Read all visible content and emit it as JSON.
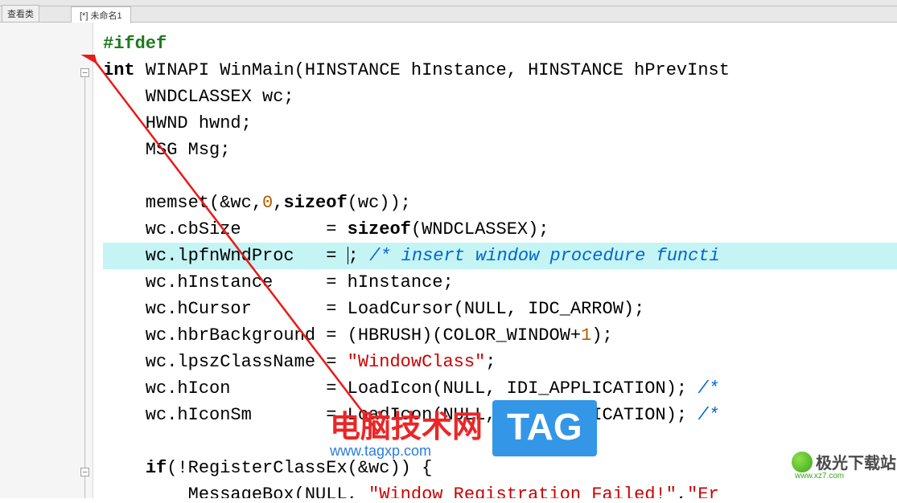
{
  "tabs": {
    "mini_label": "查看类",
    "doc_label": "[*] 未命名1"
  },
  "code": {
    "l1_a": "#ifdef",
    "l2_a": "int",
    "l2_b": " WINAPI WinMain(HINSTANCE hInstance, HINSTANCE hPrevInst",
    "l3": "    WNDCLASSEX wc;",
    "l4": "    HWND hwnd;",
    "l5": "    MSG Msg;",
    "l6": "",
    "l7_a": "    memset(&wc,",
    "l7_b": "0",
    "l7_c": ",",
    "l7_d": "sizeof",
    "l7_e": "(wc));",
    "l8_a": "    wc.cbSize        = ",
    "l8_b": "sizeof",
    "l8_c": "(WNDCLASSEX);",
    "l9_a": "    wc.lpfnWndProc   = ",
    "l9_b": "; ",
    "l9_c": "/* insert window procedure functi",
    "l10": "    wc.hInstance     = hInstance;",
    "l11": "    wc.hCursor       = LoadCursor(NULL, IDC_ARROW);",
    "l12_a": "    wc.hbrBackground = (HBRUSH)(COLOR_WINDOW+",
    "l12_b": "1",
    "l12_c": ");",
    "l13_a": "    wc.lpszClassName = ",
    "l13_b": "\"WindowClass\"",
    "l13_c": ";",
    "l14_a": "    wc.hIcon         = LoadIcon(NULL, IDI_APPLICATION); ",
    "l14_b": "/*",
    "l15_a": "    wc.hIconSm       = LoadIcon(NULL, IDI_APPLICATION); ",
    "l15_b": "/*",
    "l16": "",
    "l17_a": "    ",
    "l17_b": "if",
    "l17_c": "(!RegisterClassEx(&wc)) {",
    "l18_a": "        MessageBox(NULL, ",
    "l18_b": "\"Window Registration Failed!\"",
    "l18_c": ",",
    "l18_d": "\"Er"
  },
  "watermark": {
    "main": "电脑技术网",
    "sub": "www.tagxp.com",
    "tag": "TAG",
    "jg_text": "极光下载站",
    "jg_url": "www.xz7.com"
  }
}
